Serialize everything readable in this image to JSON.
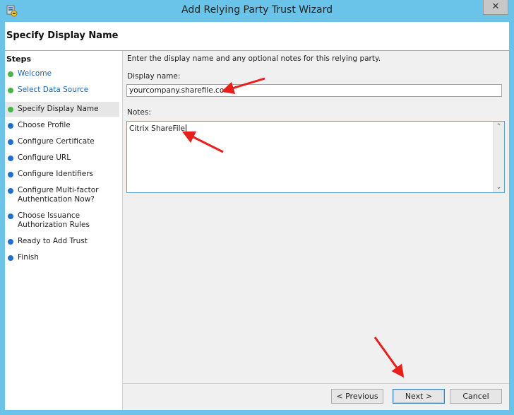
{
  "window": {
    "title": "Add Relying Party Trust Wizard",
    "close_glyph": "✕"
  },
  "header": {
    "title": "Specify Display Name"
  },
  "steps": {
    "title": "Steps",
    "items": [
      {
        "label": "Welcome",
        "state": "completed"
      },
      {
        "label": "Select Data Source",
        "state": "completed"
      },
      {
        "label": "Specify Display Name",
        "state": "current"
      },
      {
        "label": "Choose Profile",
        "state": "pending"
      },
      {
        "label": "Configure Certificate",
        "state": "pending"
      },
      {
        "label": "Configure URL",
        "state": "pending"
      },
      {
        "label": "Configure Identifiers",
        "state": "pending"
      },
      {
        "label": "Configure Multi-factor Authentication Now?",
        "state": "pending"
      },
      {
        "label": "Choose Issuance Authorization Rules",
        "state": "pending"
      },
      {
        "label": "Ready to Add Trust",
        "state": "pending"
      },
      {
        "label": "Finish",
        "state": "pending"
      }
    ]
  },
  "main": {
    "intro": "Enter the display name and any optional notes for this relying party.",
    "display_name_label": "Display name:",
    "display_name_value": "yourcompany.sharefile.com",
    "notes_label": "Notes:",
    "notes_value": "Citrix ShareFile"
  },
  "buttons": {
    "previous": "< Previous",
    "next": "Next >",
    "cancel": "Cancel"
  },
  "colors": {
    "title_bar": "#6ac3e8",
    "completed_dot": "#4ab34a",
    "pending_dot": "#1b6ed3",
    "link_text": "#1a66b8",
    "annotation_arrow": "#e8201c"
  }
}
